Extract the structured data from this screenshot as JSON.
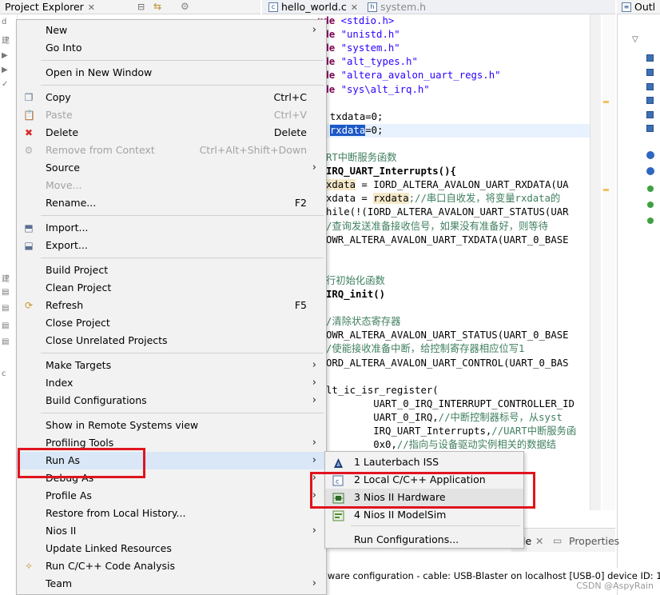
{
  "project_explorer": {
    "tab_label": "Project Explorer",
    "tree_marks": [
      "d",
      "建",
      "▶",
      "▶",
      "✓",
      "建",
      "▤",
      "▤",
      "▤",
      "▤",
      "c"
    ]
  },
  "editor": {
    "tabs": [
      {
        "label": "hello_world.c",
        "active": true
      },
      {
        "label": "system.h",
        "active": false
      }
    ],
    "lines": [
      {
        "kind": "include",
        "prefix": "ude ",
        "arg": "<stdio.h>"
      },
      {
        "kind": "include",
        "prefix": "ude ",
        "arg": "\"unistd.h\""
      },
      {
        "kind": "include",
        "prefix": "ude ",
        "arg": "\"system.h\""
      },
      {
        "kind": "include",
        "prefix": "ude ",
        "arg": "\"alt_types.h\""
      },
      {
        "kind": "include",
        "prefix": "ude ",
        "arg": "\"altera_avalon_uart_regs.h\""
      },
      {
        "kind": "include",
        "prefix": "ude ",
        "arg": "\"sys\\alt_irq.h\""
      },
      {
        "kind": "blank"
      },
      {
        "kind": "plain",
        "text": "8 txdata=0;"
      },
      {
        "kind": "selected",
        "pre": "8 ",
        "sel": "rxdata",
        "post": "=0;"
      },
      {
        "kind": "blank"
      },
      {
        "kind": "comment",
        "text": "RT中断服务函数"
      },
      {
        "kind": "fn",
        "text": "IRQ_UART_Interrupts(){"
      },
      {
        "kind": "occ1",
        "occ": "xdata",
        "rest": " = IORD_ALTERA_AVALON_UART_RXDATA(UA"
      },
      {
        "kind": "occ2",
        "pre": "xdata = ",
        "occ": "rxdata",
        "cmt": ";//串口自收发，将变量rxdata的"
      },
      {
        "kind": "plain",
        "text": "hile(!(IORD_ALTERA_AVALON_UART_STATUS(UAR"
      },
      {
        "kind": "comment",
        "text": "/查询发送准备接收信号，如果没有准备好，则等待"
      },
      {
        "kind": "plain",
        "text": "OWR_ALTERA_AVALON_UART_TXDATA(UART_0_BASE"
      },
      {
        "kind": "blank"
      },
      {
        "kind": "blank"
      },
      {
        "kind": "comment",
        "text": "行初始化函数"
      },
      {
        "kind": "fn",
        "text": "IRQ_init()"
      },
      {
        "kind": "blank"
      },
      {
        "kind": "comment",
        "text": "/清除状态寄存器"
      },
      {
        "kind": "plain",
        "text": "OWR_ALTERA_AVALON_UART_STATUS(UART_0_BASE"
      },
      {
        "kind": "comment",
        "text": "/使能接收准备中断，给控制寄存器相应位写1"
      },
      {
        "kind": "plain",
        "text": "ORD_ALTERA_AVALON_UART_CONTROL(UART_0_BAS"
      },
      {
        "kind": "blank"
      },
      {
        "kind": "plain",
        "text": "lt_ic_isr_register("
      },
      {
        "kind": "plain",
        "text": "        UART_0_IRQ_INTERRUPT_CONTROLLER_ID"
      },
      {
        "kind": "mixed",
        "pre": "        UART_0_IRQ,",
        "cmt": "//中断控制器标号，从syst"
      },
      {
        "kind": "mixed",
        "pre": "        IRQ_UART_Interrupts,",
        "cmt": "//UART中断服务函"
      },
      {
        "kind": "mixed",
        "pre": "        0x0,",
        "cmt": "//指向与设备驱动实例相关的数据结"
      }
    ]
  },
  "outline": {
    "tab_label": "Outl"
  },
  "bottom_panel": {
    "tab1_label": "le",
    "tab2_label": "Properties"
  },
  "status_text": "rdware configuration - cable: USB-Blaster on localhost [USB-0] device ID: 1 instance ID",
  "watermark": "CSDN @AspyRain",
  "context_menu": {
    "items": [
      {
        "id": "new",
        "label": "New",
        "submenu": true
      },
      {
        "id": "go-into",
        "label": "Go Into"
      },
      {
        "sep": true
      },
      {
        "id": "open-new-window",
        "label": "Open in New Window"
      },
      {
        "sep": true
      },
      {
        "id": "copy",
        "label": "Copy",
        "shortcut": "Ctrl+C",
        "icon": "copy-icon",
        "glyph": "❐"
      },
      {
        "id": "paste",
        "label": "Paste",
        "shortcut": "Ctrl+V",
        "icon": "paste-icon",
        "glyph": "📋",
        "disabled": true
      },
      {
        "id": "delete",
        "label": "Delete",
        "shortcut": "Delete",
        "icon": "delete-icon",
        "glyph": "✖"
      },
      {
        "id": "remove-from-context",
        "label": "Remove from Context",
        "shortcut": "Ctrl+Alt+Shift+Down",
        "icon": "remove-context-icon",
        "glyph": "⚙",
        "disabled": true
      },
      {
        "id": "source",
        "label": "Source",
        "submenu": true
      },
      {
        "id": "move",
        "label": "Move...",
        "disabled": true
      },
      {
        "id": "rename",
        "label": "Rename...",
        "shortcut": "F2"
      },
      {
        "sep": true
      },
      {
        "id": "import",
        "label": "Import...",
        "icon": "import-icon",
        "glyph": "⬒"
      },
      {
        "id": "export",
        "label": "Export...",
        "icon": "export-icon",
        "glyph": "⬓"
      },
      {
        "sep": true
      },
      {
        "id": "build-project",
        "label": "Build Project"
      },
      {
        "id": "clean-project",
        "label": "Clean Project"
      },
      {
        "id": "refresh",
        "label": "Refresh",
        "shortcut": "F5",
        "icon": "refresh-icon",
        "glyph": "⟳"
      },
      {
        "id": "close-project",
        "label": "Close Project"
      },
      {
        "id": "close-unrelated",
        "label": "Close Unrelated Projects"
      },
      {
        "sep": true
      },
      {
        "id": "make-targets",
        "label": "Make Targets",
        "submenu": true
      },
      {
        "id": "index",
        "label": "Index",
        "submenu": true
      },
      {
        "id": "build-configurations",
        "label": "Build Configurations",
        "submenu": true
      },
      {
        "sep": true
      },
      {
        "id": "show-remote",
        "label": "Show in Remote Systems view"
      },
      {
        "id": "profiling-tools",
        "label": "Profiling Tools",
        "submenu": true
      },
      {
        "id": "run-as",
        "label": "Run As",
        "submenu": true,
        "hover": true
      },
      {
        "id": "debug-as",
        "label": "Debug As",
        "submenu": true
      },
      {
        "id": "profile-as",
        "label": "Profile As",
        "submenu": true
      },
      {
        "id": "restore-history",
        "label": "Restore from Local History..."
      },
      {
        "id": "nios-ii",
        "label": "Nios II",
        "submenu": true
      },
      {
        "id": "update-linked",
        "label": "Update Linked Resources"
      },
      {
        "id": "code-analysis",
        "label": "Run C/C++ Code Analysis",
        "icon": "code-analysis-icon",
        "glyph": "✧"
      },
      {
        "id": "team",
        "label": "Team",
        "submenu": true
      }
    ]
  },
  "run_as_submenu": {
    "items": [
      {
        "id": "lauterbach",
        "label": "1 Lauterbach ISS",
        "icon": "lauterbach-icon"
      },
      {
        "id": "local-cpp",
        "label": "2 Local C/C++ Application",
        "icon": "c-application-icon"
      },
      {
        "id": "nios-hardware",
        "label": "3 Nios II Hardware",
        "icon": "nios-hardware-icon",
        "hover": true
      },
      {
        "id": "nios-modelsim",
        "label": "4 Nios II ModelSim",
        "icon": "modelsim-icon"
      },
      {
        "sep": true
      },
      {
        "id": "run-configurations",
        "label": "Run Configurations..."
      }
    ]
  },
  "colors": {
    "annotation_red": "#e0141e",
    "menu_bg": "#f2f2f2",
    "hover": "#d9e7f7"
  }
}
